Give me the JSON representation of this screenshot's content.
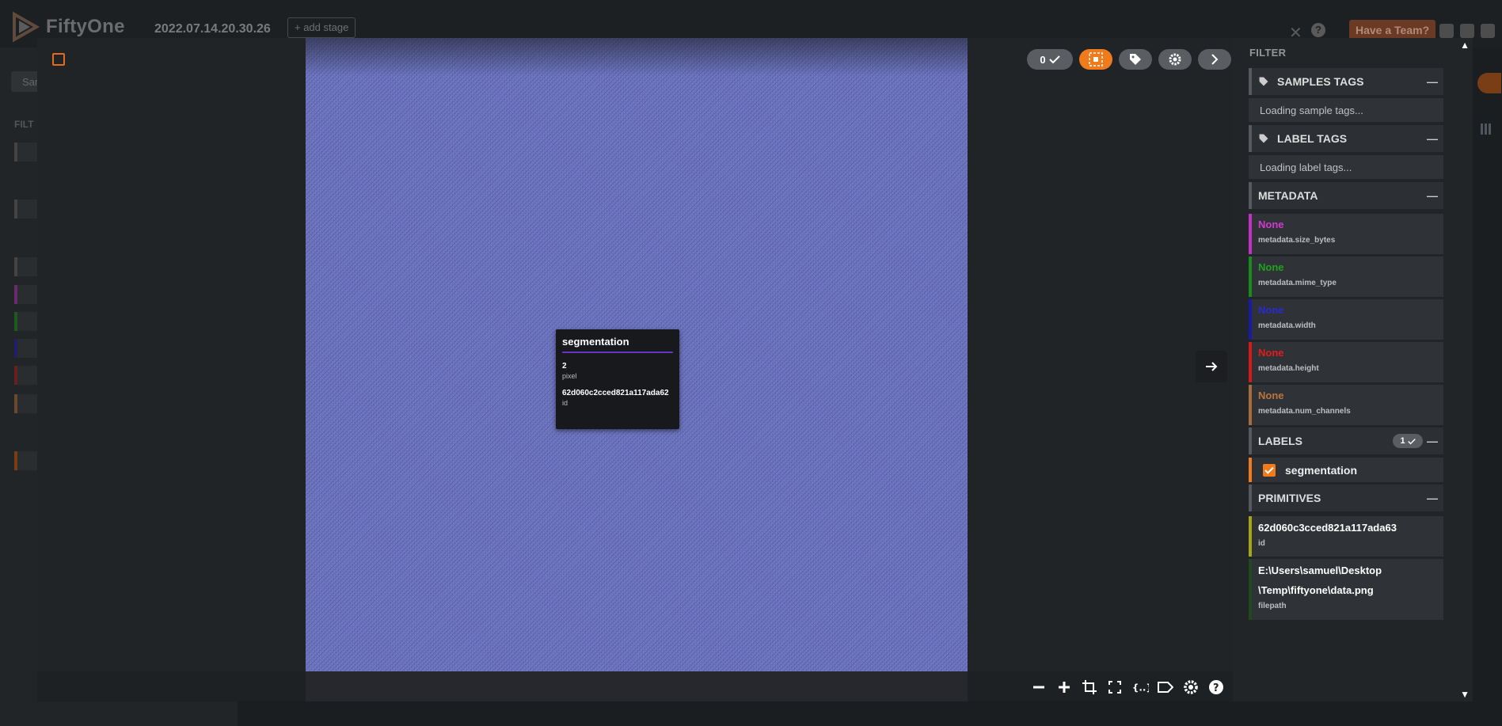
{
  "app": {
    "name": "FiftyOne",
    "dataset_name": "2022.07.14.20.30.26",
    "add_stage": "+ add stage",
    "team_button": "Have a Team?",
    "samples_tab": "Sam",
    "bg_filter_label": "FILT"
  },
  "colors": {
    "accent": "#f07b1d",
    "tooltip_underline": "#6a2fc4",
    "size_bytes": "#c430c4",
    "mime_type": "#1a8a1a",
    "width": "#1a1aa8",
    "height": "#d31a1a",
    "num_channels": "#a86b3a",
    "id_primitive": "#a5a517",
    "filepath_primitive": "#1e4a1e"
  },
  "viewer": {
    "selected_count": "0",
    "tooltip": {
      "title": "segmentation",
      "pixel_value": "2",
      "pixel_key": "pixel",
      "id_value": "62d060c2cced821a117ada62",
      "id_key": "id"
    },
    "icons": [
      "minus-icon",
      "plus-icon",
      "crop-icon",
      "fullscreen-icon",
      "json-icon",
      "label-icon",
      "settings-icon",
      "help-icon"
    ]
  },
  "filter": {
    "title": "FILTER",
    "sample_tags": {
      "label": "SAMPLES TAGS",
      "loading": "Loading sample tags..."
    },
    "label_tags": {
      "label": "LABEL TAGS",
      "loading": "Loading label tags..."
    },
    "metadata": {
      "label": "METADATA",
      "fields": [
        {
          "value": "None",
          "key": "metadata.size_bytes"
        },
        {
          "value": "None",
          "key": "metadata.mime_type"
        },
        {
          "value": "None",
          "key": "metadata.width"
        },
        {
          "value": "None",
          "key": "metadata.height"
        },
        {
          "value": "None",
          "key": "metadata.num_channels"
        }
      ]
    },
    "labels": {
      "label": "LABELS",
      "count": "1",
      "items": [
        {
          "name": "segmentation",
          "checked": true
        }
      ]
    },
    "primitives": {
      "label": "PRIMITIVES",
      "items": [
        {
          "value": "62d060c3cced821a117ada63",
          "key": "id"
        },
        {
          "value_line1": "E:\\Users\\samuel\\Desktop",
          "value_line2": "\\Temp\\fiftyone\\data.png",
          "key": "filepath"
        }
      ]
    }
  }
}
